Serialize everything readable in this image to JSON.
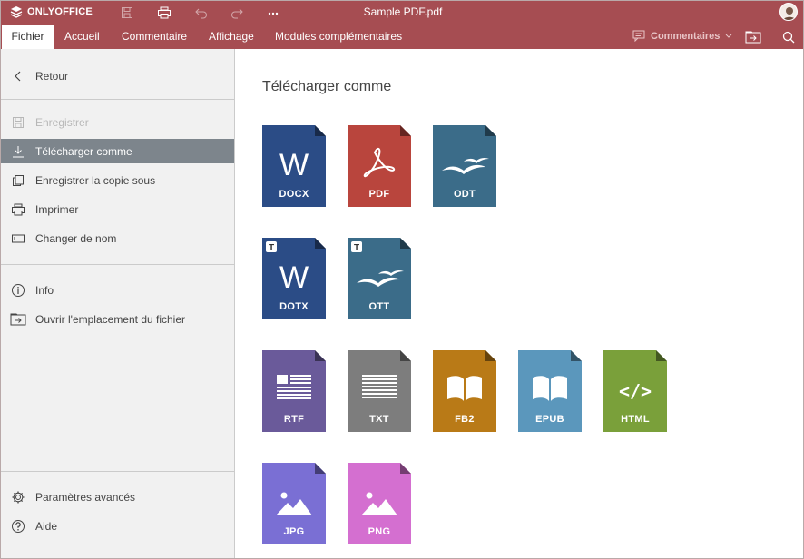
{
  "app": {
    "logo_text": "ONLYOFFICE",
    "document_title": "Sample PDF.pdf"
  },
  "titlebar_icons": [
    "save-icon",
    "print-icon",
    "undo-icon",
    "redo-icon",
    "more-icon"
  ],
  "tabs": [
    {
      "label": "Fichier",
      "active": true
    },
    {
      "label": "Accueil"
    },
    {
      "label": "Commentaire"
    },
    {
      "label": "Affichage"
    },
    {
      "label": "Modules complémentaires"
    }
  ],
  "toolbar_right": {
    "comments_label": "Commentaires"
  },
  "sidebar": {
    "back": "Retour",
    "items": [
      {
        "label": "Enregistrer",
        "icon": "save-icon",
        "disabled": true
      },
      {
        "label": "Télécharger comme",
        "icon": "download-icon",
        "active": true
      },
      {
        "label": "Enregistrer la copie sous",
        "icon": "copy-icon"
      },
      {
        "label": "Imprimer",
        "icon": "print-icon"
      },
      {
        "label": "Changer de nom",
        "icon": "rename-icon"
      }
    ],
    "items2": [
      {
        "label": "Info",
        "icon": "info-icon"
      },
      {
        "label": "Ouvrir l'emplacement du fichier",
        "icon": "open-location-icon"
      }
    ],
    "bottom": [
      {
        "label": "Paramètres avancés",
        "icon": "gear-icon"
      },
      {
        "label": "Aide",
        "icon": "help-icon"
      }
    ]
  },
  "main": {
    "title": "Télécharger comme",
    "formats": [
      {
        "label": "DOCX",
        "color": "#2b4c86",
        "glyph": "W"
      },
      {
        "label": "PDF",
        "color": "#b9453d",
        "glyph": "acrobat"
      },
      {
        "label": "ODT",
        "color": "#3b6c89",
        "glyph": "gulls"
      },
      {
        "label": "DOTX",
        "color": "#2b4c86",
        "glyph": "W",
        "template": "T"
      },
      {
        "label": "OTT",
        "color": "#3b6c89",
        "glyph": "gulls",
        "template": "T"
      },
      {
        "label": "RTF",
        "color": "#6a5a9a",
        "glyph": "rtf"
      },
      {
        "label": "TXT",
        "color": "#7d7d7d",
        "glyph": "txt"
      },
      {
        "label": "FB2",
        "color": "#b97a17",
        "glyph": "book"
      },
      {
        "label": "EPUB",
        "color": "#5b97bc",
        "glyph": "book"
      },
      {
        "label": "HTML",
        "color": "#7aa03a",
        "glyph": "code"
      },
      {
        "label": "JPG",
        "color": "#7a6fd4",
        "glyph": "image"
      },
      {
        "label": "PNG",
        "color": "#d46fd0",
        "glyph": "image"
      }
    ]
  }
}
